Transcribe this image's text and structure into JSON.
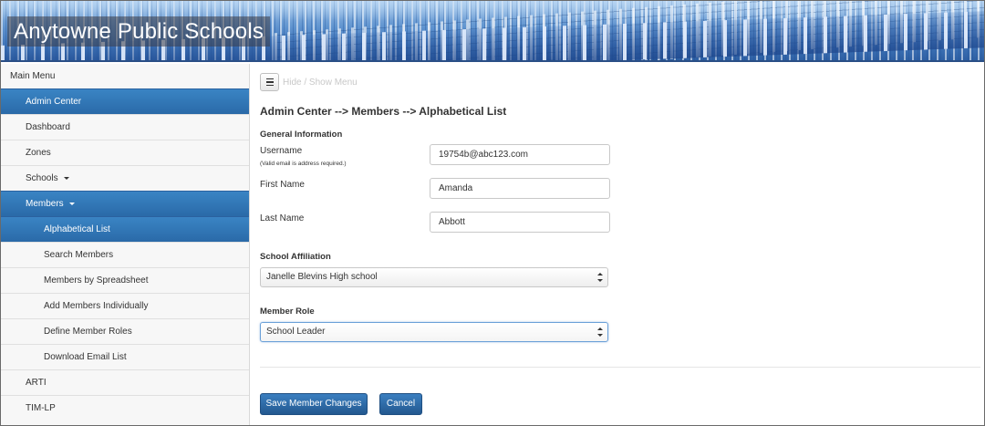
{
  "header": {
    "site_title": "Anytowne Public Schools"
  },
  "sidebar": {
    "main_menu_label": "Main Menu",
    "items": [
      {
        "label": "Admin Center",
        "active": true
      },
      {
        "label": "Dashboard"
      },
      {
        "label": "Zones"
      },
      {
        "label": "Schools",
        "caret": true
      },
      {
        "label": "Members",
        "caret": true,
        "active": true
      },
      {
        "label": "Alphabetical List",
        "sub": true,
        "active": true
      },
      {
        "label": "Search Members",
        "sub": true
      },
      {
        "label": "Members by Spreadsheet",
        "sub": true
      },
      {
        "label": "Add Members Individually",
        "sub": true
      },
      {
        "label": "Define Member Roles",
        "sub": true
      },
      {
        "label": "Download Email List",
        "sub": true
      },
      {
        "label": "ARTI"
      },
      {
        "label": "TIM-LP"
      }
    ]
  },
  "main": {
    "toggle_menu_label": "Hide / Show Menu",
    "page_title": "Admin Center --> Members --> Alphabetical List",
    "general_info_label": "General Information",
    "username": {
      "label": "Username",
      "hint": "(Valid email is address required.)",
      "value": "19754b@abc123.com"
    },
    "first_name": {
      "label": "First Name",
      "value": "Amanda"
    },
    "last_name": {
      "label": "Last Name",
      "value": "Abbott"
    },
    "school_affiliation": {
      "label": "School Affiliation",
      "selected": "Janelle Blevins High school"
    },
    "member_role": {
      "label": "Member Role",
      "selected": "School Leader"
    },
    "save_button_label": "Save Member Changes",
    "cancel_button_label": "Cancel"
  },
  "colors": {
    "accent": "#2a6aa8",
    "button": "#23588f"
  },
  "icons": {
    "menu_toggle": "hamburger-icon",
    "dropdown": "chevron-updown-icon",
    "caret": "caret-down-icon"
  }
}
